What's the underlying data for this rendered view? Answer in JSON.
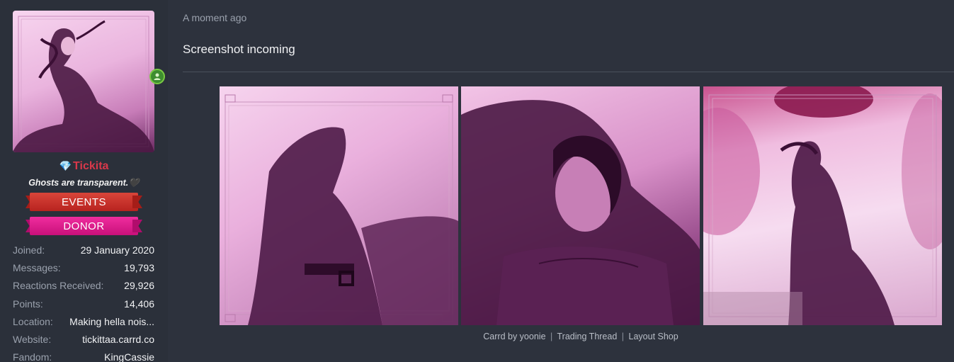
{
  "user": {
    "name": "Tickita",
    "title": "Ghosts are transparent.",
    "title_suffix": "🖤",
    "banners": [
      "EVENTS",
      "DONOR"
    ],
    "online_status": "online",
    "stats": [
      {
        "label": "Joined:",
        "value": "29 January 2020"
      },
      {
        "label": "Messages:",
        "value": "19,793"
      },
      {
        "label": "Reactions Received:",
        "value": "29,926"
      },
      {
        "label": "Points:",
        "value": "14,406"
      },
      {
        "label": "Location:",
        "value": "Making hella nois..."
      },
      {
        "label": "Website:",
        "value": "tickittaa.carrd.co"
      },
      {
        "label": "Fandom:",
        "value": "KingCassie"
      }
    ]
  },
  "post": {
    "timestamp": "A moment ago",
    "message": "Screenshot incoming",
    "credits": {
      "prefix": "Carrd by yoonie",
      "links": [
        "Trading Thread",
        "Layout Shop"
      ],
      "separator": "|"
    }
  },
  "icons": {
    "online": "user-online-icon",
    "gem": "gem-icon"
  },
  "colors": {
    "background": "#2d323d",
    "username": "#d9384a",
    "events_banner": "#c62c25",
    "donor_banner": "#e11b8c",
    "online": "#7ac943"
  }
}
